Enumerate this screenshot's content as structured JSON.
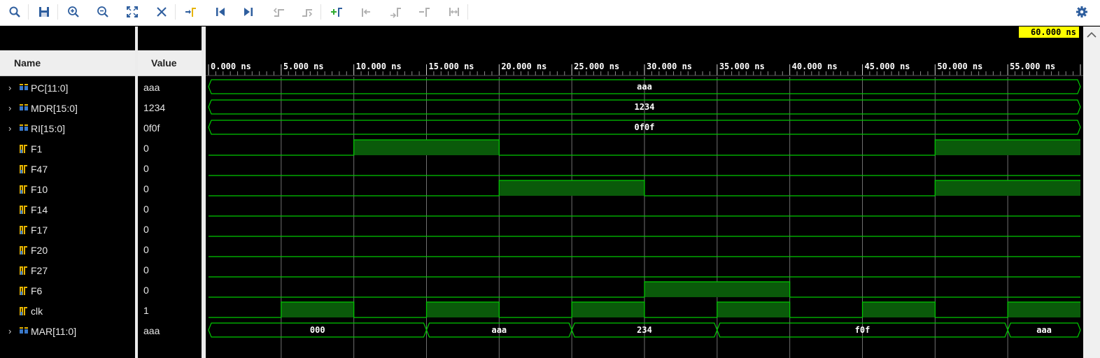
{
  "toolbar": {
    "icons": [
      "search-icon",
      "save-icon",
      "zoom-in-icon",
      "zoom-out-icon",
      "zoom-fit-icon",
      "cursor-to-zero-icon",
      "go-to-time-icon",
      "go-to-start-icon",
      "go-to-end-icon",
      "previous-transition-icon",
      "next-transition-icon",
      "add-marker-icon",
      "previous-marker-icon",
      "next-marker-icon",
      "remove-marker-icon",
      "swap-cursors-icon",
      "settings-gear-icon"
    ]
  },
  "columns": {
    "name": "Name",
    "value": "Value"
  },
  "cursor_time": "60.000 ns",
  "time_axis": {
    "unit": "ns",
    "start": 0,
    "end": 60,
    "labels": [
      "0.000 ns",
      "5.000 ns",
      "10.000 ns",
      "15.000 ns",
      "20.000 ns",
      "25.000 ns",
      "30.000 ns",
      "35.000 ns",
      "40.000 ns",
      "45.000 ns",
      "50.000 ns",
      "55.000 ns"
    ]
  },
  "signals": [
    {
      "name": "PC[11:0]",
      "value": "aaa",
      "bus": true,
      "segments": [
        {
          "start": 0,
          "end": 60,
          "label": "aaa"
        }
      ]
    },
    {
      "name": "MDR[15:0]",
      "value": "1234",
      "bus": true,
      "segments": [
        {
          "start": 0,
          "end": 60,
          "label": "1234"
        }
      ]
    },
    {
      "name": "RI[15:0]",
      "value": "0f0f",
      "bus": true,
      "segments": [
        {
          "start": 0,
          "end": 60,
          "label": "0f0f"
        }
      ]
    },
    {
      "name": "F1",
      "value": "0",
      "bus": false,
      "high": [
        [
          10,
          20
        ],
        [
          50,
          60
        ]
      ]
    },
    {
      "name": "F47",
      "value": "0",
      "bus": false,
      "high": []
    },
    {
      "name": "F10",
      "value": "0",
      "bus": false,
      "high": [
        [
          20,
          30
        ],
        [
          50,
          60
        ]
      ]
    },
    {
      "name": "F14",
      "value": "0",
      "bus": false,
      "high": []
    },
    {
      "name": "F17",
      "value": "0",
      "bus": false,
      "high": []
    },
    {
      "name": "F20",
      "value": "0",
      "bus": false,
      "high": []
    },
    {
      "name": "F27",
      "value": "0",
      "bus": false,
      "high": []
    },
    {
      "name": "F6",
      "value": "0",
      "bus": false,
      "high": [
        [
          30,
          40
        ]
      ]
    },
    {
      "name": "clk",
      "value": "1",
      "bus": false,
      "high": [
        [
          5,
          10
        ],
        [
          15,
          20
        ],
        [
          25,
          30
        ],
        [
          35,
          40
        ],
        [
          45,
          50
        ],
        [
          55,
          60
        ]
      ]
    },
    {
      "name": "MAR[11:0]",
      "value": "aaa",
      "bus": true,
      "segments": [
        {
          "start": 0,
          "end": 15,
          "label": "000"
        },
        {
          "start": 15,
          "end": 25,
          "label": "aaa"
        },
        {
          "start": 25,
          "end": 35,
          "label": "234"
        },
        {
          "start": 35,
          "end": 55,
          "label": "f0f"
        },
        {
          "start": 55,
          "end": 60,
          "label": "aaa"
        }
      ]
    }
  ],
  "colors": {
    "wave": "#00c800",
    "fill": "#0a5a0a",
    "grid": "#707070",
    "cursor_bg": "#ffff00",
    "accent": "#2e5e9e"
  }
}
